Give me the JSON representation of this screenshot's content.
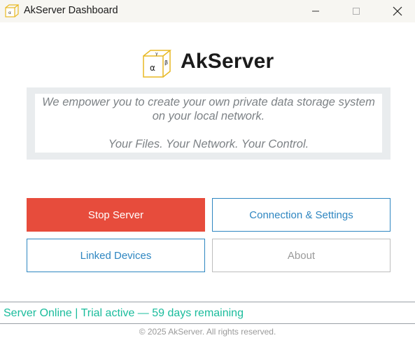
{
  "window": {
    "title": "AkServer Dashboard"
  },
  "header": {
    "app_name": "AkServer",
    "logo_letters": {
      "alpha": "α",
      "beta": "β",
      "gamma": "γ"
    }
  },
  "tagline": {
    "line1": "We empower you to create your own private data storage system",
    "line2": "on your local network.",
    "line3": "Your Files. Your Network. Your Control."
  },
  "buttons": {
    "stop_server": "Stop Server",
    "connection_settings": "Connection & Settings",
    "linked_devices": "Linked Devices",
    "about": "About"
  },
  "status": {
    "text": "Server Online | Trial active — 59 days remaining"
  },
  "footer": {
    "copyright": "© 2025 AkServer. All rights reserved."
  },
  "colors": {
    "stop_button": "#e74c3c",
    "primary_blue": "#2e86c1",
    "status_green": "#1abc9c",
    "logo_gold": "#e8b923"
  },
  "icons": {
    "app": "cube-logo-icon",
    "minimize": "minimize-icon",
    "maximize": "maximize-icon",
    "close": "close-icon"
  }
}
